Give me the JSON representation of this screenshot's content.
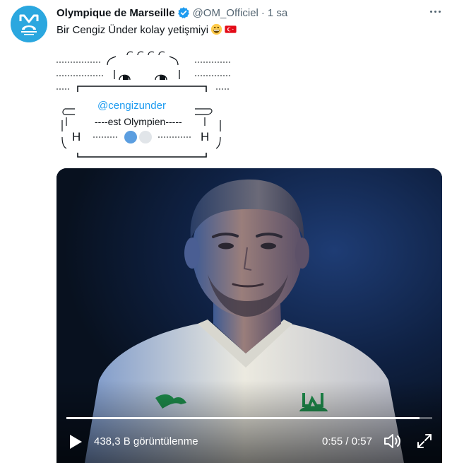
{
  "tweet": {
    "author_name": "Olympique de Marseille",
    "handle": "@OM_Officiel",
    "separator": "·",
    "time": "1 sa",
    "text": "Bir Cengiz Ünder kolay yetişmiyi",
    "emojis": [
      "grinning-face-icon",
      "turkey-flag-icon"
    ],
    "ascii_art": {
      "mention": "@cengizunder",
      "line": "----est Olympien-----",
      "letter_left": "H",
      "letter_right": "H"
    }
  },
  "video": {
    "views": "438,3 B görüntülenme",
    "current_time": "0:55",
    "duration": "0:57",
    "time_separator": " / ",
    "progress": 0.965
  },
  "colors": {
    "accent": "#1d9bf0",
    "avatar_bg": "#2ba7df",
    "text": "#0f1419",
    "secondary_text": "#536471"
  }
}
